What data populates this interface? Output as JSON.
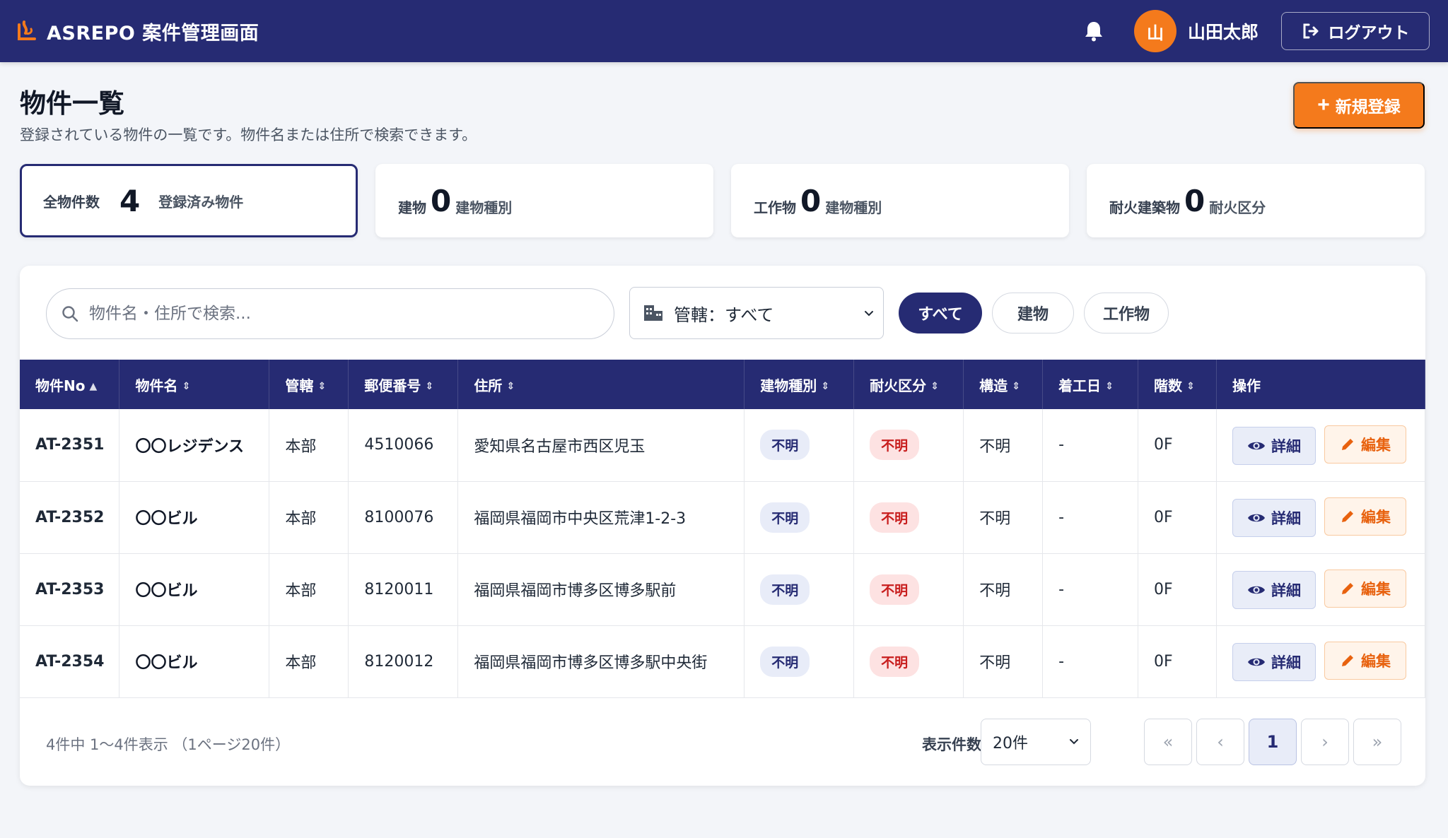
{
  "header": {
    "title": "ASREPO 案件管理画面",
    "user_initial": "山",
    "username": "山田太郎",
    "logout_label": "ログアウト"
  },
  "page": {
    "title": "物件一覧",
    "description": "登録されている物件の一覧です。物件名または住所で検索できます。",
    "new_button": "新規登録"
  },
  "stats": [
    {
      "label": "全物件数",
      "value": "4",
      "sub": "登録済み物件"
    },
    {
      "label": "建物",
      "value": "0",
      "sub": "建物種別"
    },
    {
      "label": "工作物",
      "value": "0",
      "sub": "建物種別"
    },
    {
      "label": "耐火建築物",
      "value": "0",
      "sub": "耐火区分"
    }
  ],
  "filters": {
    "search_placeholder": "物件名・住所で検索...",
    "jurisdiction_select": "管轄：すべて",
    "chips": [
      "すべて",
      "建物",
      "工作物"
    ]
  },
  "table": {
    "columns": [
      "物件No",
      "物件名",
      "管轄",
      "郵便番号",
      "住所",
      "建物種別",
      "耐火区分",
      "構造",
      "着工日",
      "階数",
      "操作"
    ],
    "rows": [
      {
        "no": "AT-2351",
        "name": "〇〇レジデンス",
        "office": "本部",
        "zip": "4510066",
        "address": "愛知県名古屋市西区児玉",
        "type": "不明",
        "fire": "不明",
        "structure": "不明",
        "start": "-",
        "floors": "0F"
      },
      {
        "no": "AT-2352",
        "name": "〇〇ビル",
        "office": "本部",
        "zip": "8100076",
        "address": "福岡県福岡市中央区荒津1-2-3",
        "type": "不明",
        "fire": "不明",
        "structure": "不明",
        "start": "-",
        "floors": "0F"
      },
      {
        "no": "AT-2353",
        "name": "〇〇ビル",
        "office": "本部",
        "zip": "8120011",
        "address": "福岡県福岡市博多区博多駅前",
        "type": "不明",
        "fire": "不明",
        "structure": "不明",
        "start": "-",
        "floors": "0F"
      },
      {
        "no": "AT-2354",
        "name": "〇〇ビル",
        "office": "本部",
        "zip": "8120012",
        "address": "福岡県福岡市博多区博多駅中央街",
        "type": "不明",
        "fire": "不明",
        "structure": "不明",
        "start": "-",
        "floors": "0F"
      }
    ],
    "detail_label": "詳細",
    "edit_label": "編集"
  },
  "footer": {
    "info": "4件中 1〜4件表示 （1ページ20件）",
    "per_page_label": "表示件数",
    "per_page_value": "20件",
    "pagination": {
      "first": "«",
      "prev": "‹",
      "current": "1",
      "next": "›",
      "last": "»"
    }
  },
  "colors": {
    "primary": "#262b73",
    "accent": "#f47a1c",
    "danger": "#c81e1e"
  }
}
